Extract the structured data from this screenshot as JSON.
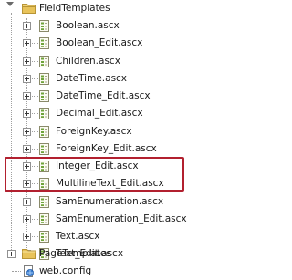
{
  "tree": {
    "folder_field_templates": "FieldTemplates",
    "files": [
      {
        "label": "Boolean.ascx"
      },
      {
        "label": "Boolean_Edit.ascx"
      },
      {
        "label": "Children.ascx"
      },
      {
        "label": "DateTime.ascx"
      },
      {
        "label": "DateTime_Edit.ascx"
      },
      {
        "label": "Decimal_Edit.ascx"
      },
      {
        "label": "ForeignKey.ascx"
      },
      {
        "label": "ForeignKey_Edit.ascx"
      },
      {
        "label": "Integer_Edit.ascx"
      },
      {
        "label": "MultilineText_Edit.ascx"
      },
      {
        "label": "SamEnumeration.ascx"
      },
      {
        "label": "SamEnumeration_Edit.ascx"
      },
      {
        "label": "Text.ascx"
      },
      {
        "label": "Text_Edit.ascx"
      }
    ],
    "folder_page_templates": "PageTemplates",
    "web_config": "web.config"
  },
  "colors": {
    "highlight_border": "#b2202f",
    "folder_yellow": "#e8c35a",
    "file_green": "#6fa33a"
  }
}
